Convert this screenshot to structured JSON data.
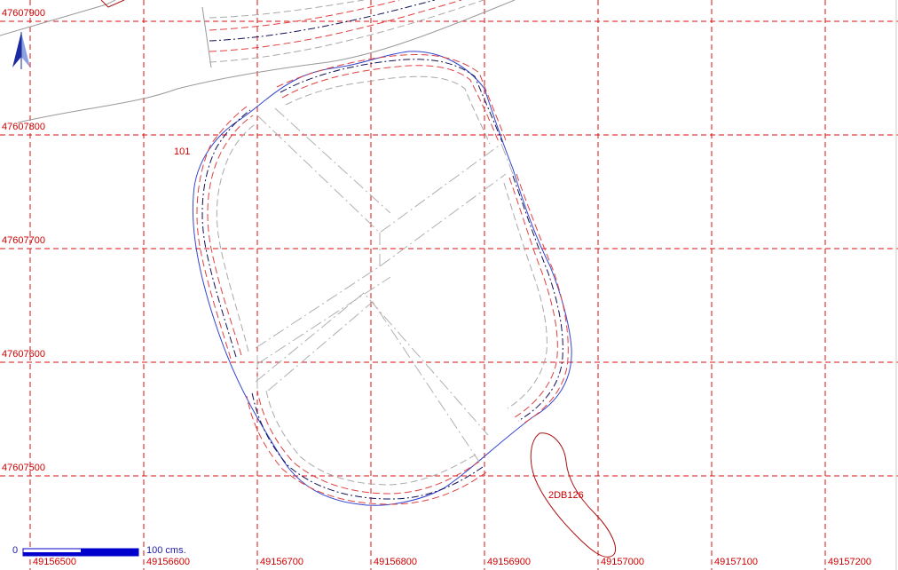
{
  "colors": {
    "grid": "#dd1111",
    "boundary": "#3344cc",
    "dashed_red": "#e04040",
    "dashed_navy": "#111155",
    "dashed_gray": "#a8a8a8",
    "terrain": "#999999",
    "feature": "#aa1111",
    "scale": "#0000cc"
  },
  "grid": {
    "x_labels": [
      "49156500",
      "49156600",
      "49156700",
      "49156800",
      "49156900",
      "49157000",
      "49157100",
      "49157200"
    ],
    "y_labels": [
      "47607900",
      "47607800",
      "47607700",
      "47607600",
      "47607500"
    ]
  },
  "features": {
    "site_label": "101",
    "pit_label": "2DB126"
  },
  "scale_bar": {
    "start_label": "0",
    "end_label": "100 cms."
  },
  "north_arrow": {
    "icon": "north-arrow-icon"
  }
}
